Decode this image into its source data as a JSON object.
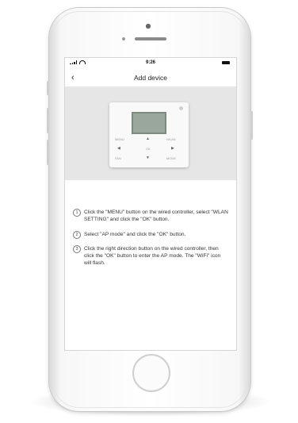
{
  "status_bar": {
    "time": "9:26"
  },
  "nav": {
    "title": "Add device",
    "back_icon": "chevron-left-icon"
  },
  "controller_buttons": {
    "menu": "MENU",
    "wlan": "WLAN",
    "left_arrow": "◀",
    "right_arrow": "▶",
    "up_arrow": "▲",
    "down_arrow": "▼",
    "ok": "OK",
    "fan": "FAN",
    "mode": "MODE"
  },
  "steps": [
    {
      "num": "1",
      "text": "Click the \"MENU\" button on the wired controller, select \"WLAN SETTING\" and click the \"OK\" button."
    },
    {
      "num": "2",
      "text": "Select \"AP mode\" and click the \"OK\" button."
    },
    {
      "num": "3",
      "text": "Click the right direction button on the wired controller, then click the \"OK\" button to enter the AP mode. The \"WiFi\" icon will flash."
    }
  ]
}
